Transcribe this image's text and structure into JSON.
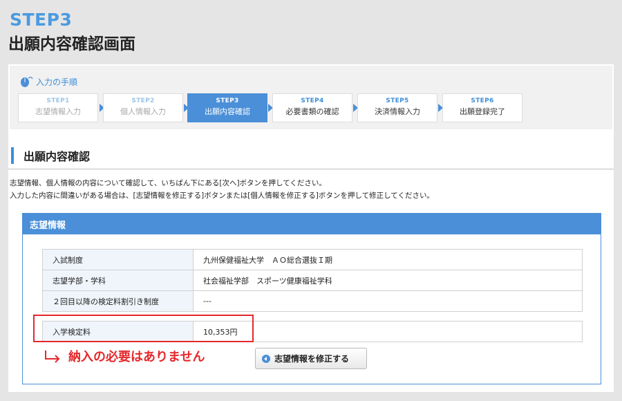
{
  "header": {
    "step_label": "STEP3",
    "title": "出願内容確認画面"
  },
  "steps_heading": "入力の手順",
  "steps": [
    {
      "num": "STEP1",
      "name": "志望情報入力",
      "state": "past"
    },
    {
      "num": "STEP2",
      "name": "個人情報入力",
      "state": "past"
    },
    {
      "num": "STEP3",
      "name": "出願内容確認",
      "state": "current"
    },
    {
      "num": "STEP4",
      "name": "必要書類の確認",
      "state": "future"
    },
    {
      "num": "STEP5",
      "name": "決済情報入力",
      "state": "future"
    },
    {
      "num": "STEP6",
      "name": "出願登録完了",
      "state": "future"
    }
  ],
  "section_title": "出願内容確認",
  "instructions": [
    "志望情報、個人情報の内容について確認して、いちばん下にある[次へ]ボタンを押してください。",
    "入力した内容に間違いがある場合は、[志望情報を修正する]ボタンまたは[個人情報を修正する]ボタンを押して修正してください。"
  ],
  "box": {
    "header": "志望情報",
    "rows": [
      {
        "label": "入試制度",
        "value": "九州保健福祉大学　ＡＯ総合選抜Ｉ期"
      },
      {
        "label": "志望学部・学科",
        "value": "社会福祉学部　スポーツ健康福祉学科"
      },
      {
        "label": "２回目以降の検定料割引き制度",
        "value": "---"
      }
    ],
    "fee": {
      "label": "入学検定料",
      "value": "10,353円"
    }
  },
  "note": "納入の必要はありません",
  "edit_button": "志望情報を修正する",
  "colors": {
    "accent": "#4a8fd8",
    "title_blue": "#4a9be0",
    "alert_red": "#e5272b"
  }
}
